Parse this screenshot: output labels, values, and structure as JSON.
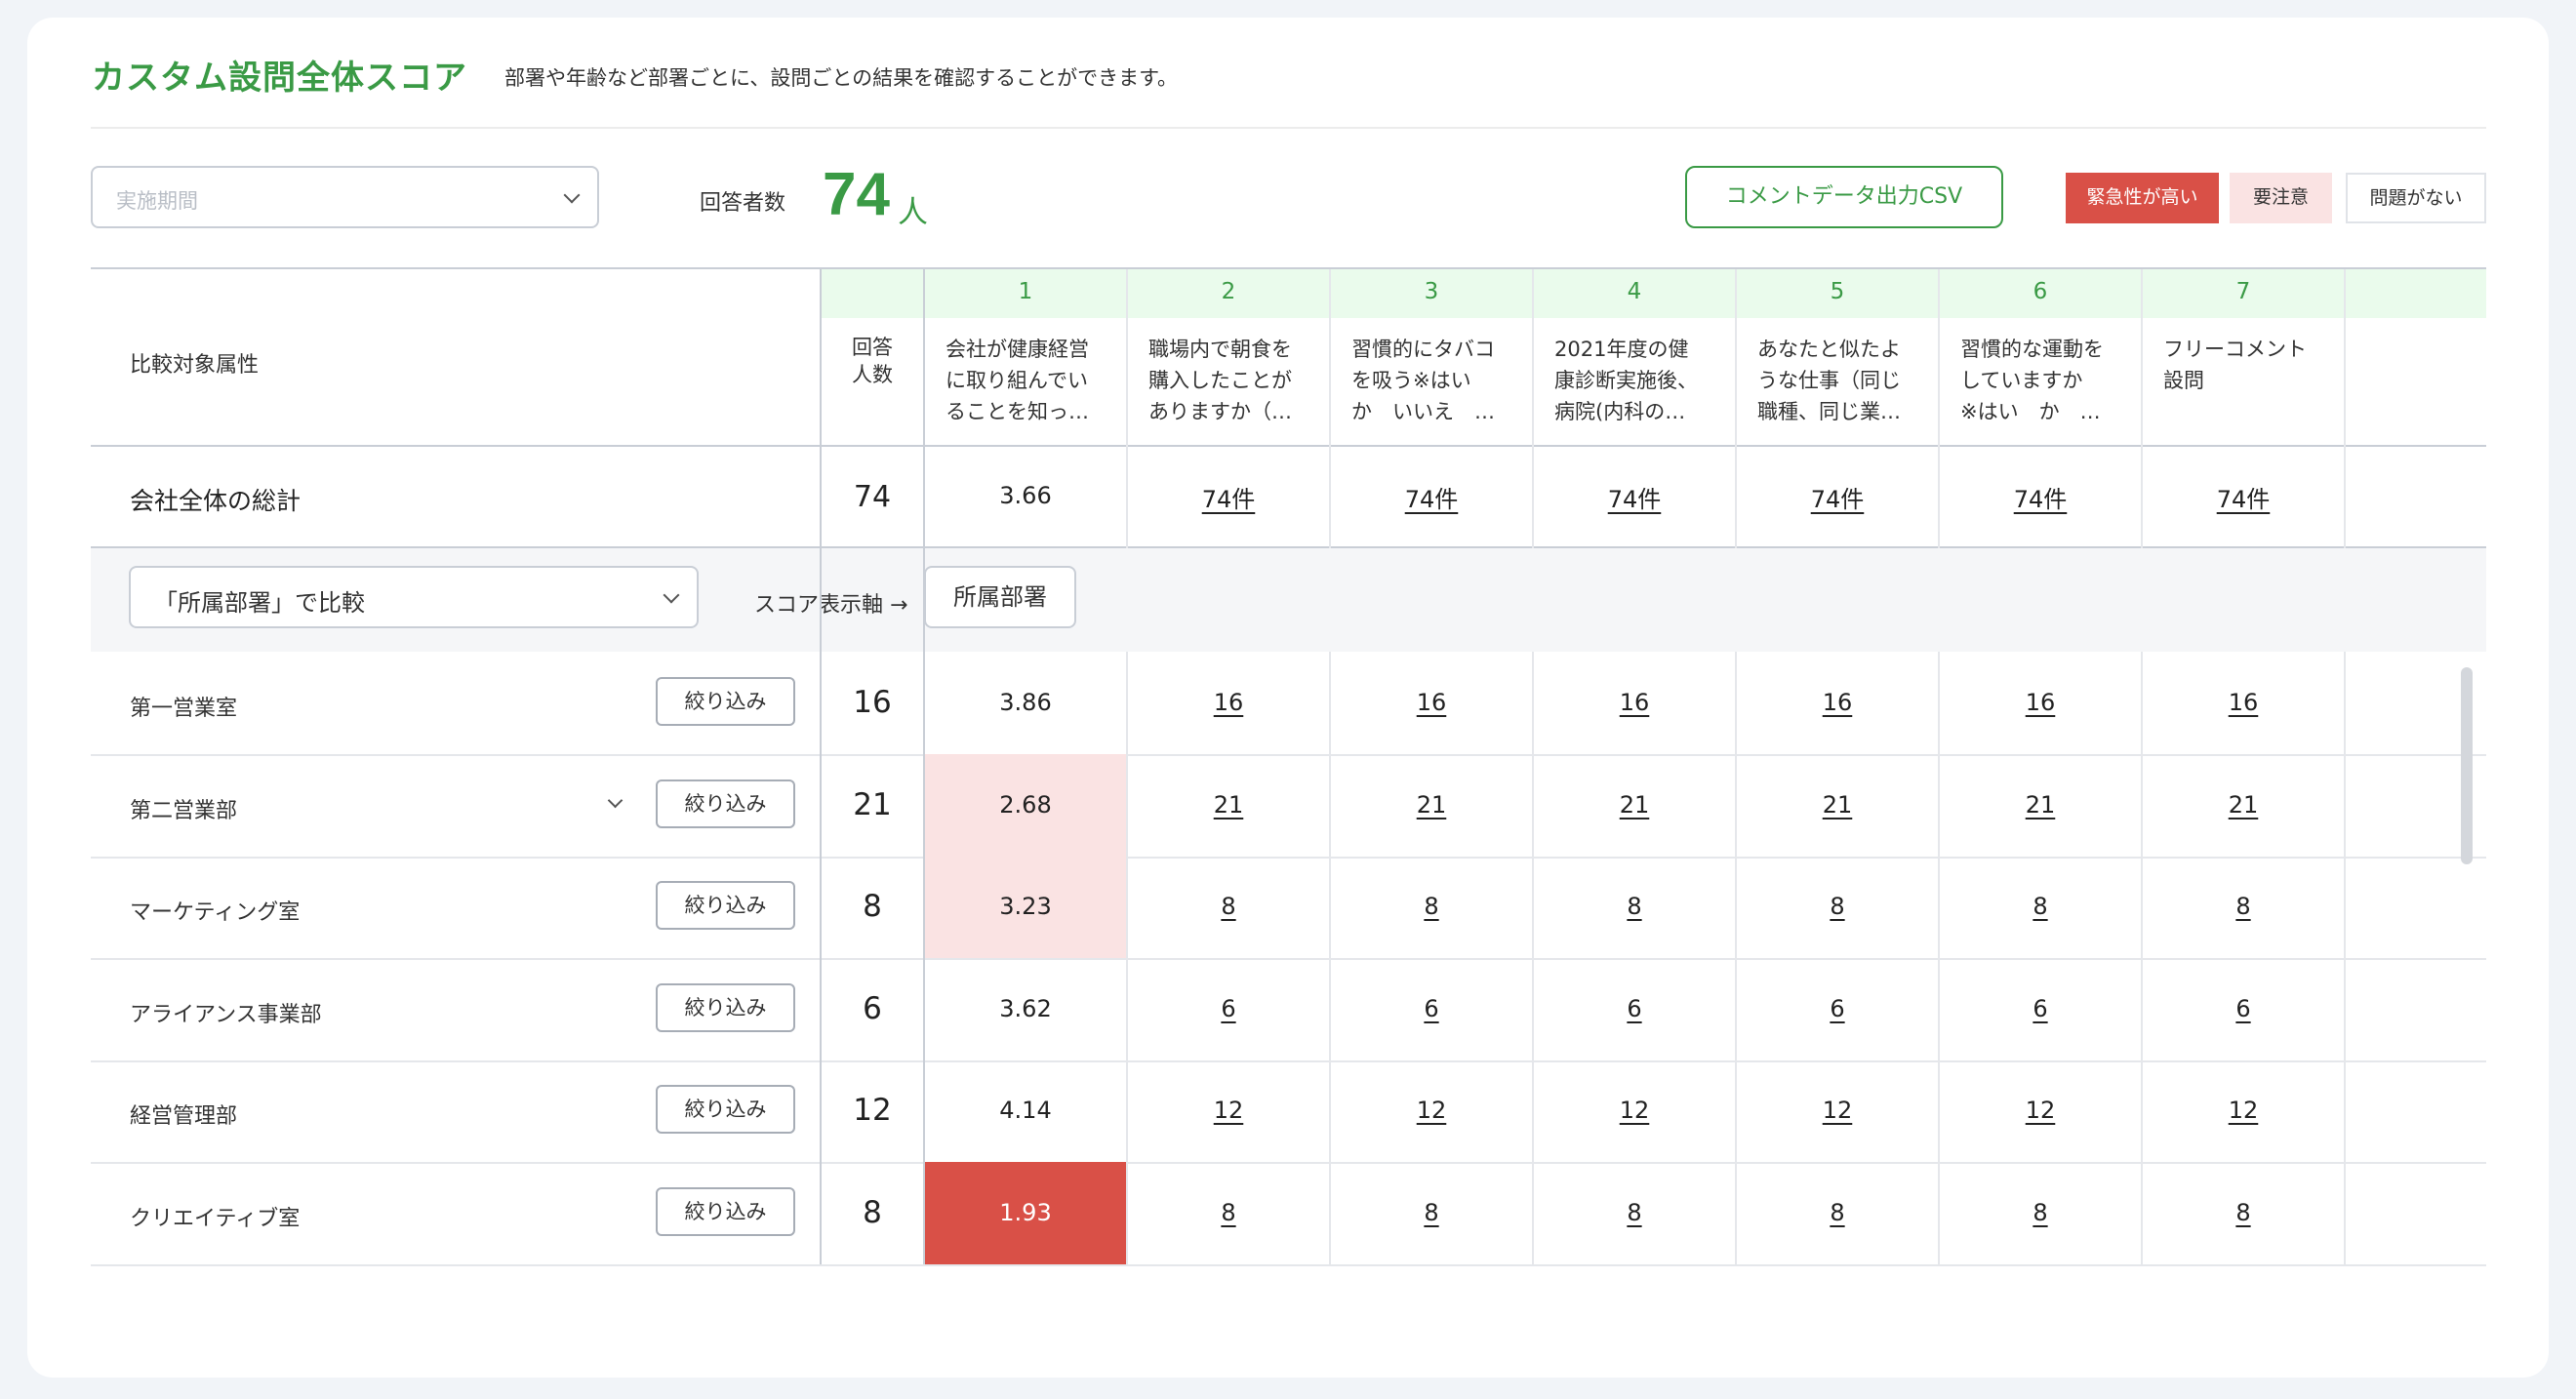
{
  "header": {
    "title": "カスタム設問全体スコア",
    "description": "部署や年齢など部署ごとに、設問ごとの結果を確認することができます。"
  },
  "controls": {
    "period_placeholder": "実施期間",
    "respondents_label": "回答者数",
    "respondents_count": "74",
    "respondents_unit": "人",
    "csv_button": "コメントデータ出力CSV",
    "legend": {
      "high": "緊急性が高い",
      "warn": "要注意",
      "ok": "問題がない"
    },
    "colors": {
      "accent": "#3a9a45",
      "high": "#d95047",
      "warn": "#fae3e3"
    }
  },
  "table": {
    "attr_header": "比較対象属性",
    "count_header": "回答\n人数",
    "questions": [
      {
        "num": "1",
        "text": "会社が健康経営\nに取り組んでい\nることを知っ…"
      },
      {
        "num": "2",
        "text": "職場内で朝食を\n購入したことが\nありますか（…"
      },
      {
        "num": "3",
        "text": "習慣的にタバコ\nを吸う※はい\nか　いいえ　…"
      },
      {
        "num": "4",
        "text": "2021年度の健\n康診断実施後、\n病院(内科の…"
      },
      {
        "num": "5",
        "text": "あなたと似たよ\nうな仕事（同じ\n職種、同じ業…"
      },
      {
        "num": "6",
        "text": "習慣的な運動を\nしていますか\n※はい　か　…"
      },
      {
        "num": "7",
        "text": "フリーコメント\n設問"
      }
    ],
    "total": {
      "label": "会社全体の総計",
      "count": "74",
      "cells": [
        "3.66",
        "74件",
        "74件",
        "74件",
        "74件",
        "74件",
        "74件"
      ]
    },
    "compare": {
      "select_value": "「所属部署」で比較",
      "axis_label": "スコア表示軸 →",
      "axis_button": "所属部署"
    },
    "filter_label": "絞り込み",
    "rows": [
      {
        "label": "第一営業室",
        "count": "16",
        "score": "3.86",
        "status": "ok",
        "cells": [
          "16",
          "16",
          "16",
          "16",
          "16",
          "16"
        ]
      },
      {
        "label": "第二営業部",
        "count": "21",
        "score": "2.68",
        "status": "warn",
        "cells": [
          "21",
          "21",
          "21",
          "21",
          "21",
          "21"
        ],
        "expandable": true
      },
      {
        "label": "マーケティング室",
        "count": "8",
        "score": "3.23",
        "status": "warn",
        "cells": [
          "8",
          "8",
          "8",
          "8",
          "8",
          "8"
        ]
      },
      {
        "label": "アライアンス事業部",
        "count": "6",
        "score": "3.62",
        "status": "ok",
        "cells": [
          "6",
          "6",
          "6",
          "6",
          "6",
          "6"
        ]
      },
      {
        "label": "経営管理部",
        "count": "12",
        "score": "4.14",
        "status": "ok",
        "cells": [
          "12",
          "12",
          "12",
          "12",
          "12",
          "12"
        ]
      },
      {
        "label": "クリエイティブ室",
        "count": "8",
        "score": "1.93",
        "status": "high",
        "cells": [
          "8",
          "8",
          "8",
          "8",
          "8",
          "8"
        ]
      }
    ]
  }
}
